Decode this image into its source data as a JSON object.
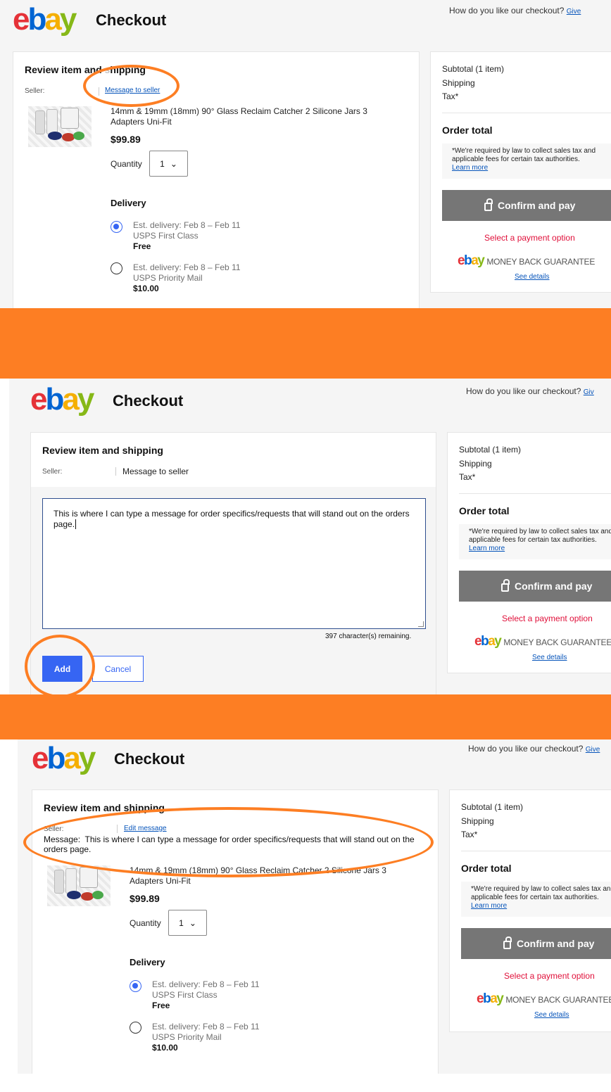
{
  "header": {
    "title": "Checkout",
    "feedback_prompt": "How do you like our checkout?",
    "feedback_link_1": "Give",
    "feedback_link_2": "Giv",
    "feedback_link_3": "Give"
  },
  "item_card": {
    "title_step1": "Review item and shipping",
    "title_visible_step1": "Review item and",
    "title_visible_step1_tail": "hipping",
    "title_step2": "Review item and shipping",
    "title_step3": "Review item and shipping",
    "seller_label": "Seller:",
    "message_link": "Message to seller",
    "message_label_plain": "Message to seller",
    "edit_message_link": "Edit message",
    "item_title": "14mm & 19mm (18mm) 90° Glass Reclaim Catcher 2 Silicone Jars 3 Adapters Uni-Fit",
    "price": "$99.89",
    "quantity_label": "Quantity",
    "quantity_value": "1",
    "delivery_heading": "Delivery",
    "delivery_options": [
      {
        "est": "Est. delivery: Feb 8 – Feb 11",
        "service": "USPS First Class",
        "cost": "Free",
        "selected": true
      },
      {
        "est": "Est. delivery: Feb 8 – Feb 11",
        "service": "USPS Priority Mail",
        "cost": "$10.00",
        "selected": false
      }
    ]
  },
  "message_editor": {
    "text": "This is where I can type a message for order specifics/requests that will stand out on the orders page.",
    "remaining": "397 character(s) remaining.",
    "add_label": "Add",
    "cancel_label": "Cancel"
  },
  "saved_message": {
    "label": "Message:",
    "text": "This is where I can type a message for order specifics/requests that will stand out on the orders page."
  },
  "summary": {
    "subtotal_label": "Subtotal (1 item)",
    "shipping_label": "Shipping",
    "tax_label": "Tax*",
    "order_total_label": "Order total",
    "tax_note_line1": "*We're required by law to collect sales tax and",
    "tax_note_line2": "applicable fees for certain tax authorities.",
    "learn_more": "Learn more",
    "confirm_pay": "Confirm and pay",
    "select_payment": "Select a payment option",
    "money_back": "MONEY BACK GUARANTEE",
    "see_details": "See details"
  },
  "colors": {
    "annotation": "#fd7e23",
    "ebay_red": "#e53238",
    "ebay_blue": "#0064d2",
    "ebay_yellow": "#f5af02",
    "ebay_green": "#86b817",
    "primary_button": "#3665f3",
    "disabled_button": "#767676",
    "warning_text": "#e0103a"
  },
  "icons": [
    "ebay-logo",
    "lock-icon",
    "chevron-down-icon",
    "radio-selected-icon",
    "radio-empty-icon",
    "textarea-resize-grip-icon"
  ]
}
